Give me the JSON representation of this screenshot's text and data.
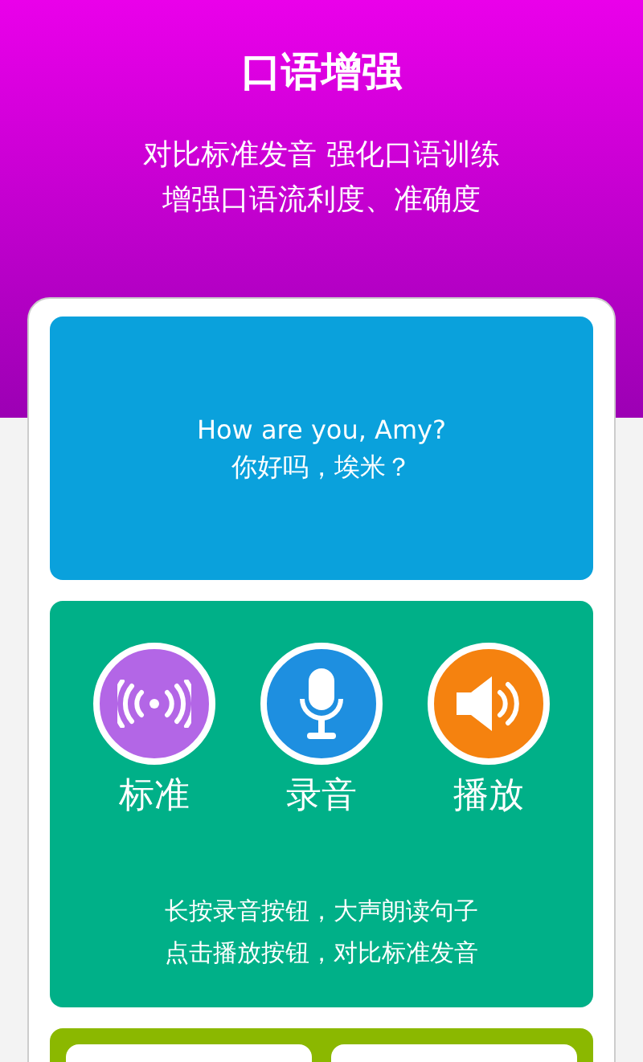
{
  "header": {
    "title": "口语增强",
    "subtitle": [
      "对比标准发音 强化口语训练",
      "增强口语流利度、准确度"
    ]
  },
  "sentence": {
    "english": "How are you, Amy?",
    "chinese": "你好吗，埃米？"
  },
  "actions": [
    {
      "kind": "standard",
      "label": "标准",
      "color": "#b366e6"
    },
    {
      "kind": "record",
      "label": "录音",
      "color": "#1e8fe0"
    },
    {
      "kind": "play",
      "label": "播放",
      "color": "#f5820f"
    }
  ],
  "hints": [
    "长按录音按钮，大声朗读句子",
    "点击播放按钮，对比标准发音"
  ]
}
